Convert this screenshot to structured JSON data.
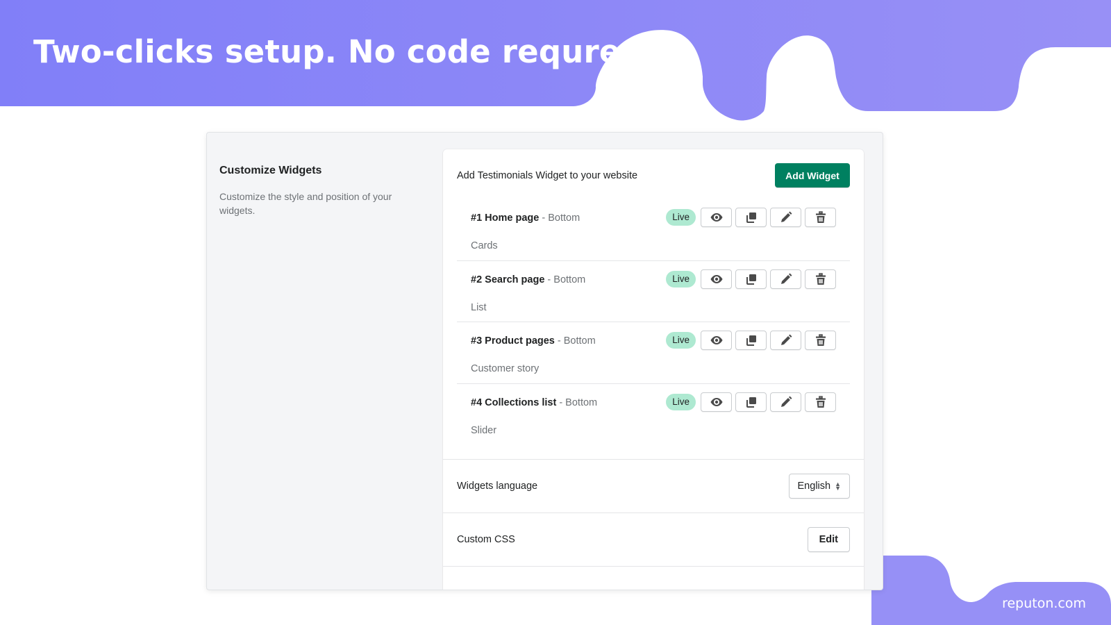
{
  "banner": {
    "headline": "Two-clicks setup. No code requred",
    "brand": "reputon.com",
    "accent_color": "#8b87f8"
  },
  "sidebar": {
    "title": "Customize Widgets",
    "description": "Customize the style and position of your widgets."
  },
  "card": {
    "intro": "Add Testimonials Widget to your website",
    "add_button": "Add Widget",
    "add_button_color": "#008060",
    "widgets": [
      {
        "number": "#1",
        "name": "Home page",
        "separator": " - ",
        "position": "Bottom",
        "type": "Cards",
        "status": "Live"
      },
      {
        "number": "#2",
        "name": "Search page",
        "separator": " - ",
        "position": "Bottom",
        "type": "List",
        "status": "Live"
      },
      {
        "number": "#3",
        "name": "Product pages",
        "separator": " - ",
        "position": "Bottom",
        "type": "Customer story",
        "status": "Live"
      },
      {
        "number": "#4",
        "name": "Collections list",
        "separator": " - ",
        "position": "Bottom",
        "type": "Slider",
        "status": "Live"
      }
    ],
    "action_icons": [
      "eye-icon",
      "duplicate-icon",
      "pencil-icon",
      "trash-icon"
    ],
    "language": {
      "label": "Widgets language",
      "selected": "English"
    },
    "custom_css": {
      "label": "Custom CSS",
      "button": "Edit"
    }
  }
}
